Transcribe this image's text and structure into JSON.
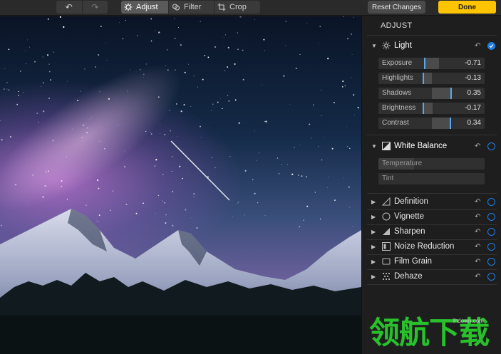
{
  "toolbar": {
    "tabs": [
      {
        "label": "Adjust",
        "icon": "adjust-icon"
      },
      {
        "label": "Filter",
        "icon": "filter-icon"
      },
      {
        "label": "Crop",
        "icon": "crop-icon"
      }
    ],
    "reset_label": "Reset Changes",
    "done_label": "Done",
    "accent": "#ffc400"
  },
  "panel": {
    "title": "ADJUST",
    "light": {
      "label": "Light",
      "enabled": true,
      "sliders": [
        {
          "label": "Exposure",
          "value": "-0.71"
        },
        {
          "label": "Highlights",
          "value": "-0.13"
        },
        {
          "label": "Shadows",
          "value": "0.35"
        },
        {
          "label": "Brightness",
          "value": "-0.17"
        },
        {
          "label": "Contrast",
          "value": "0.34"
        }
      ]
    },
    "white_balance": {
      "label": "White Balance",
      "enabled": false,
      "sliders": [
        {
          "label": "Temperature"
        },
        {
          "label": "Tint"
        }
      ]
    },
    "sections": [
      {
        "label": "Definition",
        "icon": "definition-icon"
      },
      {
        "label": "Vignette",
        "icon": "vignette-icon"
      },
      {
        "label": "Sharpen",
        "icon": "sharpen-icon"
      },
      {
        "label": "Noize Reduction",
        "icon": "noise-reduction-icon"
      },
      {
        "label": "Film Grain",
        "icon": "film-grain-icon"
      },
      {
        "label": "Dehaze",
        "icon": "dehaze-icon"
      }
    ],
    "toggle_color": "#1e7de0"
  },
  "watermark": {
    "url": "lhdown.com",
    "text": "领航下载"
  }
}
